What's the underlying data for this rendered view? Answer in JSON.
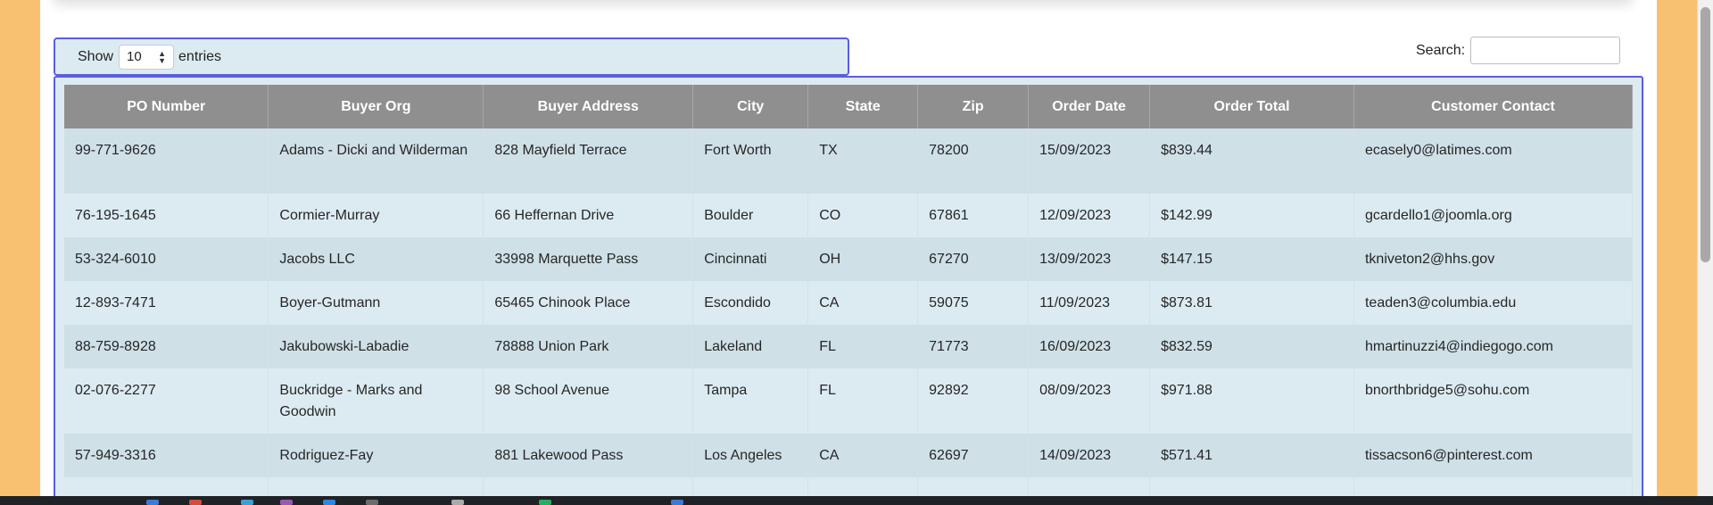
{
  "length_control": {
    "show_label": "Show",
    "value": "10",
    "entries_label": "entries"
  },
  "search": {
    "label": "Search:",
    "value": "",
    "placeholder": ""
  },
  "table": {
    "columns": [
      "PO Number",
      "Buyer Org",
      "Buyer Address",
      "City",
      "State",
      "Zip",
      "Order Date",
      "Order Total",
      "Customer Contact"
    ],
    "rows": [
      {
        "po": "99-771-9626",
        "org": "Adams - Dicki and Wilderman",
        "address": "828 Mayfield Terrace",
        "city": "Fort Worth",
        "state": "TX",
        "zip": "78200",
        "date": "15/09/2023",
        "total": "$839.44",
        "contact": "ecasely0@latimes.com"
      },
      {
        "po": "76-195-1645",
        "org": "Cormier-Murray",
        "address": "66 Heffernan Drive",
        "city": "Boulder",
        "state": "CO",
        "zip": "67861",
        "date": "12/09/2023",
        "total": "$142.99",
        "contact": "gcardello1@joomla.org"
      },
      {
        "po": "53-324-6010",
        "org": "Jacobs LLC",
        "address": "33998 Marquette Pass",
        "city": "Cincinnati",
        "state": "OH",
        "zip": "67270",
        "date": "13/09/2023",
        "total": "$147.15",
        "contact": "tkniveton2@hhs.gov"
      },
      {
        "po": "12-893-7471",
        "org": "Boyer-Gutmann",
        "address": "65465 Chinook Place",
        "city": "Escondido",
        "state": "CA",
        "zip": "59075",
        "date": "11/09/2023",
        "total": "$873.81",
        "contact": "teaden3@columbia.edu"
      },
      {
        "po": "88-759-8928",
        "org": "Jakubowski-Labadie",
        "address": "78888 Union Park",
        "city": "Lakeland",
        "state": "FL",
        "zip": "71773",
        "date": "16/09/2023",
        "total": "$832.59",
        "contact": "hmartinuzzi4@indiegogo.com"
      },
      {
        "po": "02-076-2277",
        "org": "Buckridge - Marks and Goodwin",
        "address": "98 School Avenue",
        "city": "Tampa",
        "state": "FL",
        "zip": "92892",
        "date": "08/09/2023",
        "total": "$971.88",
        "contact": "bnorthbridge5@sohu.com"
      },
      {
        "po": "57-949-3316",
        "org": "Rodriguez-Fay",
        "address": "881 Lakewood Pass",
        "city": "Los Angeles",
        "state": "CA",
        "zip": "62697",
        "date": "14/09/2023",
        "total": "$571.41",
        "contact": "tissacson6@pinterest.com"
      }
    ]
  },
  "icons": {
    "select_arrows": "up-down-chevron-icon"
  },
  "colors": {
    "page_background": "#f8c171",
    "header_background": "#8f8f8f",
    "row_odd": "#cfe0e7",
    "row_even": "#dcebf1",
    "focus_border": "#5a5ee0"
  }
}
